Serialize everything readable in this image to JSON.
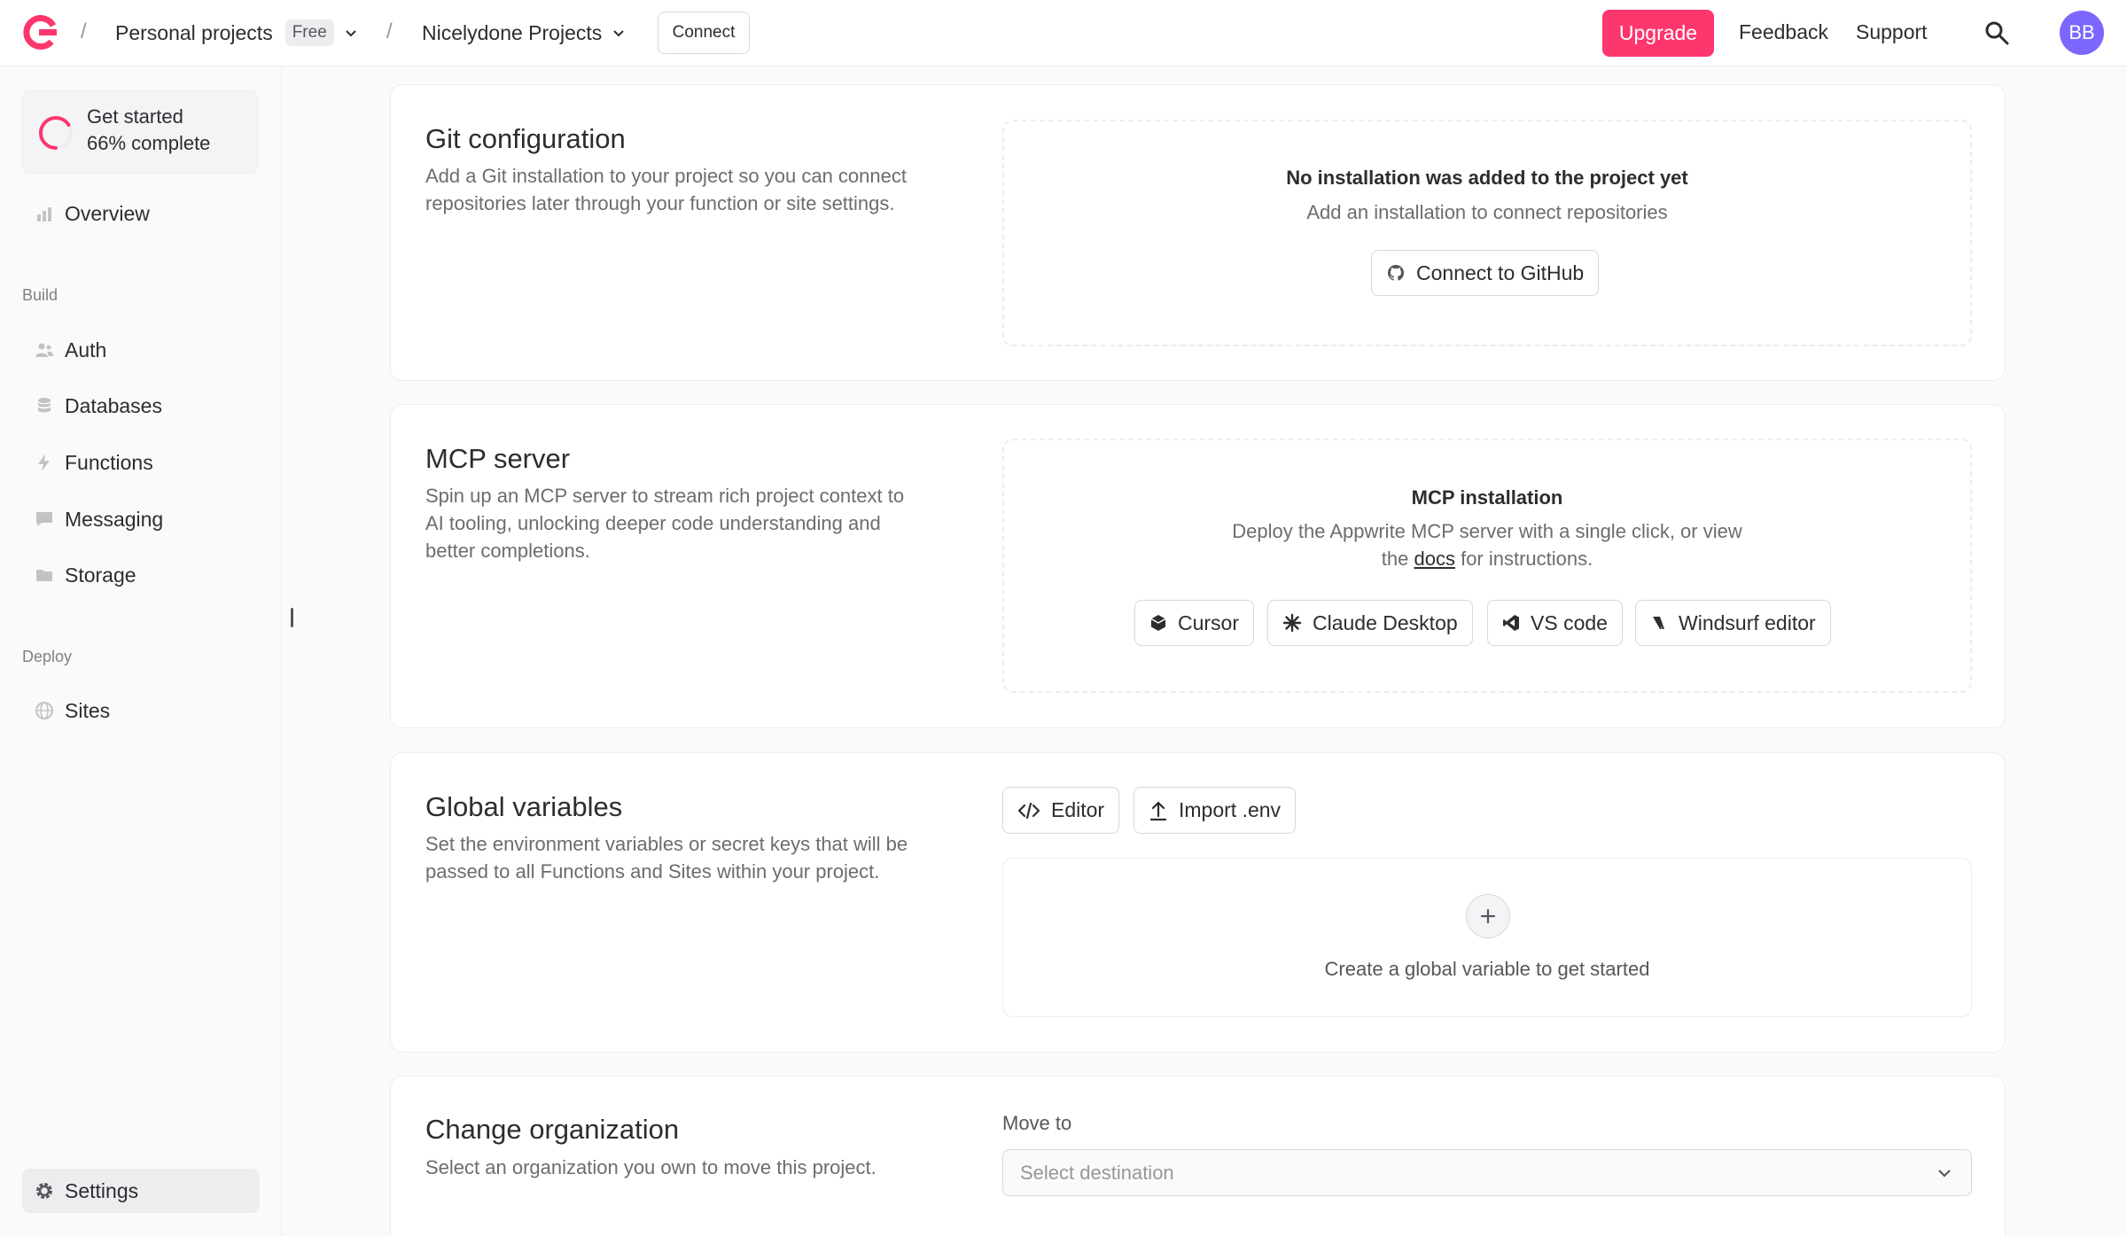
{
  "topbar": {
    "org_name": "Personal projects",
    "org_plan": "Free",
    "project_name": "Nicelydone Projects",
    "connect_label": "Connect",
    "upgrade_label": "Upgrade",
    "feedback_label": "Feedback",
    "support_label": "Support",
    "avatar_initials": "BB",
    "brand_color": "#fd366e",
    "avatar_color": "#7c67fe"
  },
  "sidebar": {
    "get_started": {
      "title": "Get started",
      "progress_text": "66% complete",
      "progress": 0.66
    },
    "overview": "Overview",
    "build_section": "Build",
    "build_items": [
      "Auth",
      "Databases",
      "Functions",
      "Messaging",
      "Storage"
    ],
    "deploy_section": "Deploy",
    "deploy_items": [
      "Sites"
    ],
    "settings": "Settings"
  },
  "git": {
    "title": "Git configuration",
    "description": "Add a Git installation to your project so you can connect repositories later through your function or site settings.",
    "empty_title": "No installation was added to the project yet",
    "empty_sub": "Add an installation to connect repositories",
    "button": "Connect to GitHub"
  },
  "mcp": {
    "title": "MCP server",
    "description": "Spin up an MCP server to stream rich project context to AI tooling, unlocking deeper code understanding and better completions.",
    "box_title": "MCP installation",
    "box_sub_1": "Deploy the Appwrite MCP server with a single click, or view",
    "box_sub_2": "the",
    "docs_link": "docs",
    "box_sub_3": "for instructions.",
    "buttons": [
      "Cursor",
      "Claude Desktop",
      "VS code",
      "Windsurf editor"
    ]
  },
  "globals": {
    "title": "Global variables",
    "description": "Set the environment variables or secret keys that will be passed to all Functions and Sites within your project.",
    "editor_label": "Editor",
    "import_label": "Import .env",
    "empty_text": "Create a global variable to get started"
  },
  "org": {
    "title": "Change organization",
    "description": "Select an organization you own to move this project.",
    "field_label": "Move to",
    "placeholder": "Select destination"
  }
}
